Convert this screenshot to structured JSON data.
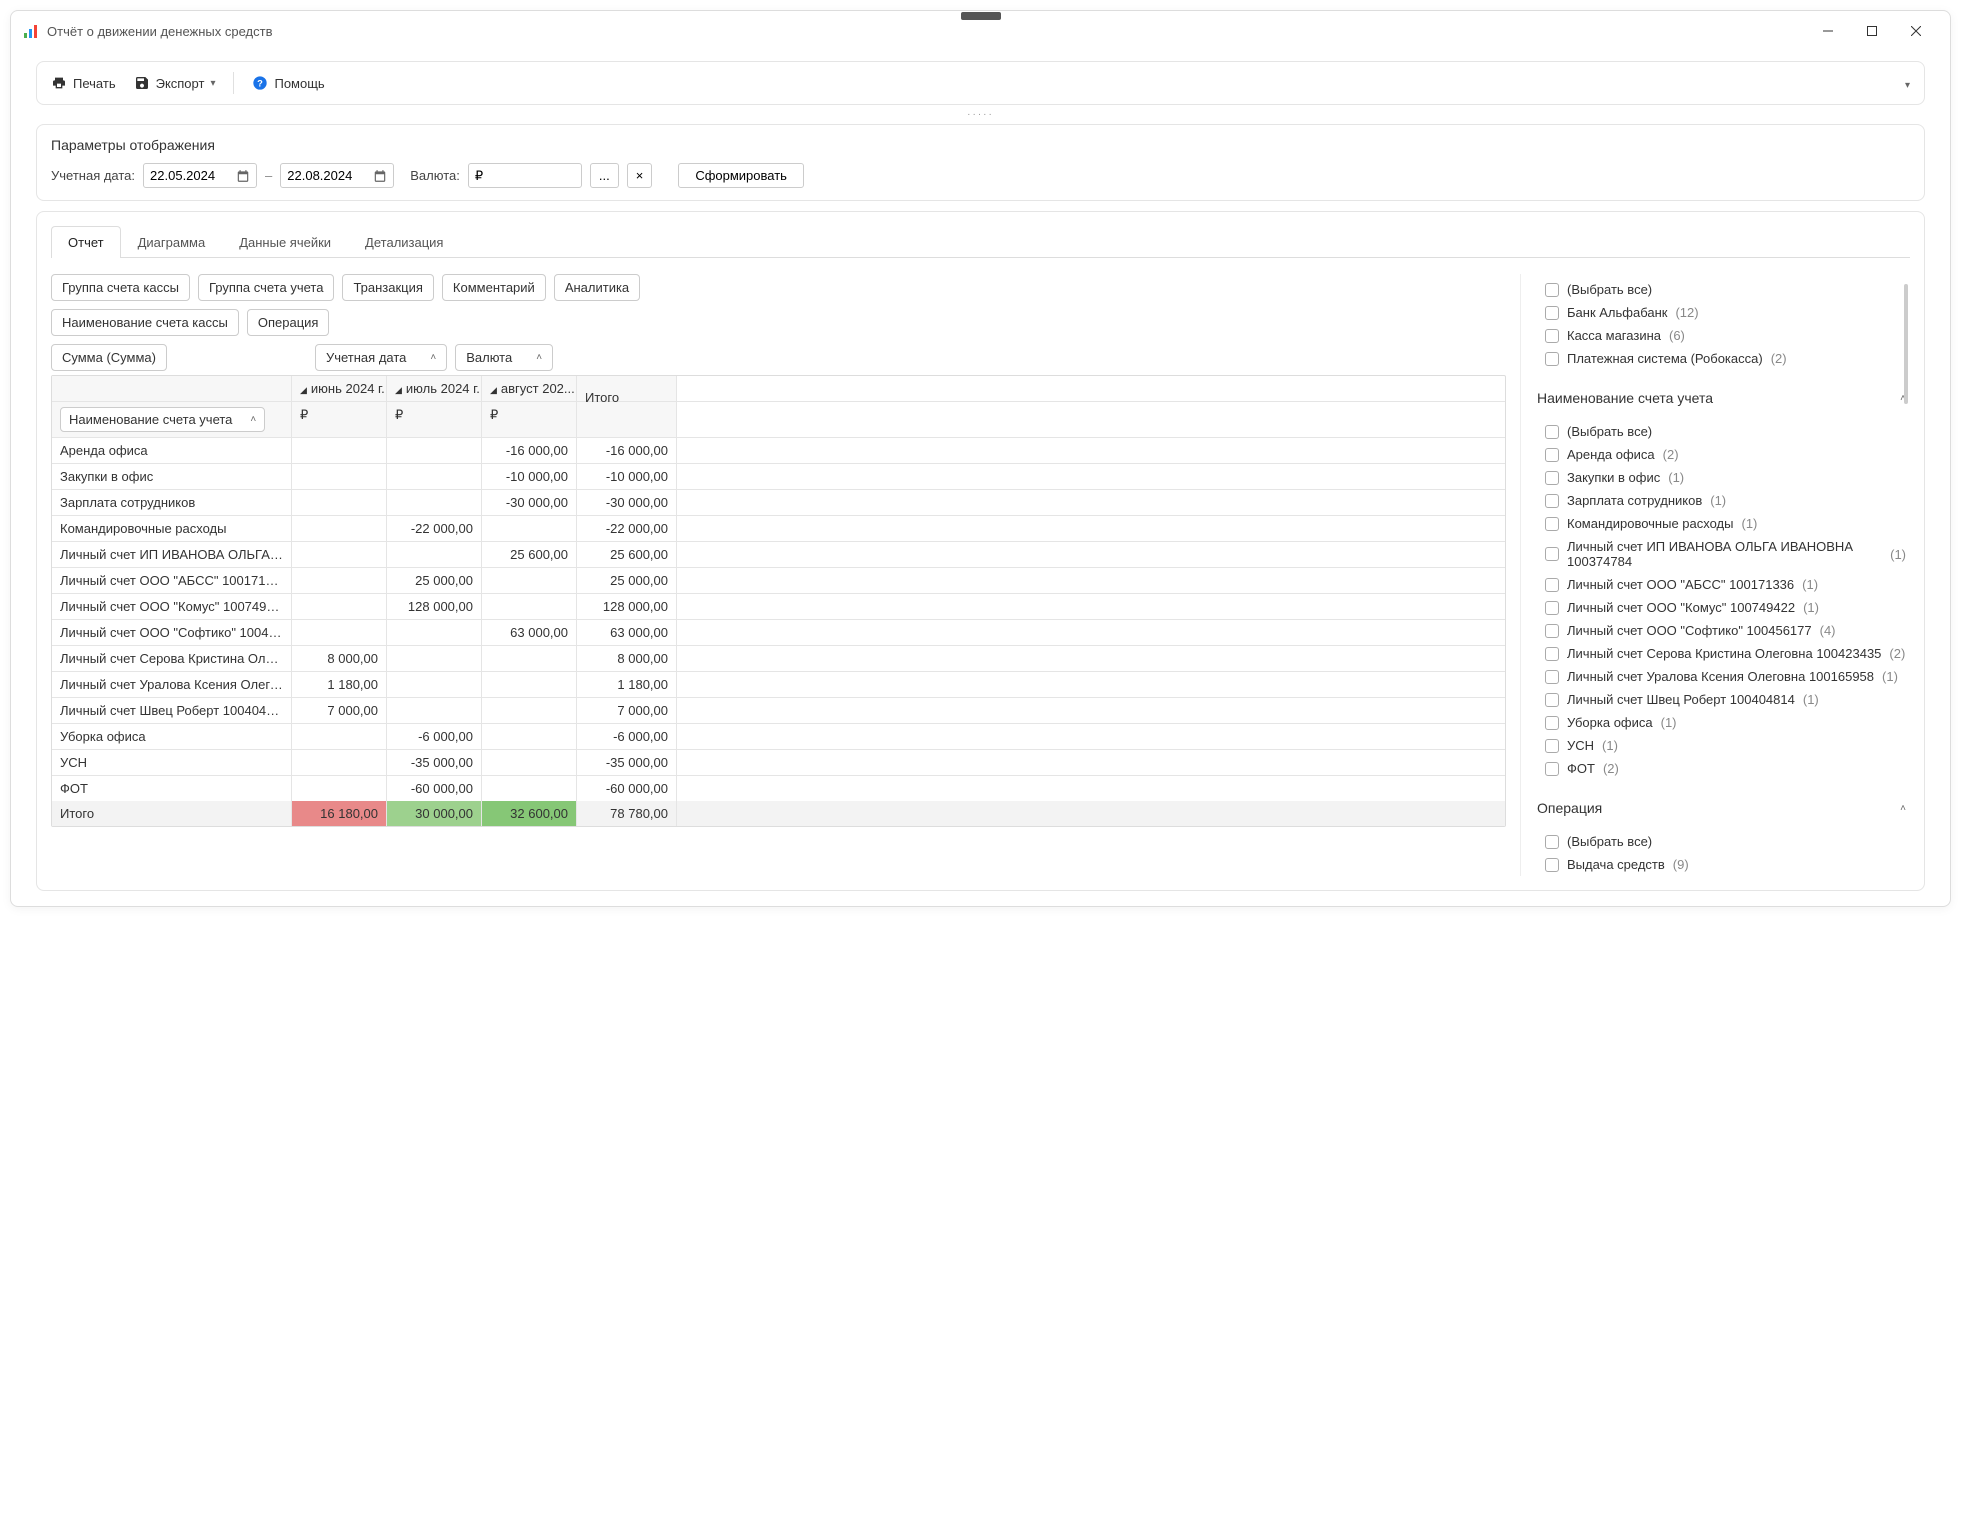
{
  "window": {
    "title": "Отчёт о движении денежных средств"
  },
  "toolbar": {
    "print": "Печать",
    "export": "Экспорт",
    "help": "Помощь"
  },
  "params": {
    "panel_title": "Параметры отображения",
    "date_label": "Учетная дата:",
    "date_from": "22.05.2024",
    "date_to": "22.08.2024",
    "currency_label": "Валюта:",
    "currency_value": "₽",
    "more_btn": "...",
    "clear_btn": "×",
    "generate_btn": "Сформировать"
  },
  "tabs": {
    "report": "Отчет",
    "diagram": "Диаграмма",
    "cell_data": "Данные ячейки",
    "detail": "Детализация"
  },
  "chips": {
    "group_kassa": "Группа счета кассы",
    "group_uchet": "Группа счета учета",
    "transaction": "Транзакция",
    "comment": "Комментарий",
    "analytics": "Аналитика",
    "name_kassa": "Наименование счета кассы",
    "operation": "Операция",
    "sum": "Сумма (Сумма)",
    "date_col": "Учетная дата",
    "currency_col": "Валюта",
    "row_field": "Наименование счета учета",
    "total_label": "Итого"
  },
  "months": {
    "jun": "июнь 2024 г.",
    "jul": "июль 2024 г.",
    "aug": "август 202...",
    "currency": "₽"
  },
  "rows": [
    {
      "name": "Аренда офиса",
      "jun": "",
      "jul": "",
      "aug": "-16 000,00",
      "total": "-16 000,00"
    },
    {
      "name": "Закупки в офис",
      "jun": "",
      "jul": "",
      "aug": "-10 000,00",
      "total": "-10 000,00"
    },
    {
      "name": "Зарплата сотрудников",
      "jun": "",
      "jul": "",
      "aug": "-30 000,00",
      "total": "-30 000,00"
    },
    {
      "name": "Командировочные расходы",
      "jun": "",
      "jul": "-22 000,00",
      "aug": "",
      "total": "-22 000,00"
    },
    {
      "name": "Личный счет ИП ИВАНОВА ОЛЬГА ИВАН...",
      "jun": "",
      "jul": "",
      "aug": "25 600,00",
      "total": "25 600,00"
    },
    {
      "name": "Личный счет ООО \"АБСС\" 100171336",
      "jun": "",
      "jul": "25 000,00",
      "aug": "",
      "total": "25 000,00"
    },
    {
      "name": "Личный счет ООО \"Комус\" 100749422",
      "jun": "",
      "jul": "128 000,00",
      "aug": "",
      "total": "128 000,00"
    },
    {
      "name": "Личный счет ООО \"Софтико\" 100456177",
      "jun": "",
      "jul": "",
      "aug": "63 000,00",
      "total": "63 000,00"
    },
    {
      "name": "Личный счет Серова Кристина Олеговна...",
      "jun": "8 000,00",
      "jul": "",
      "aug": "",
      "total": "8 000,00"
    },
    {
      "name": "Личный счет Уралова Ксения Олеговна 1...",
      "jun": "1 180,00",
      "jul": "",
      "aug": "",
      "total": "1 180,00"
    },
    {
      "name": "Личный счет Швец Роберт 100404814",
      "jun": "7 000,00",
      "jul": "",
      "aug": "",
      "total": "7 000,00"
    },
    {
      "name": "Уборка офиса",
      "jun": "",
      "jul": "-6 000,00",
      "aug": "",
      "total": "-6 000,00"
    },
    {
      "name": "УСН",
      "jun": "",
      "jul": "-35 000,00",
      "aug": "",
      "total": "-35 000,00"
    },
    {
      "name": "ФОТ",
      "jun": "",
      "jul": "-60 000,00",
      "aug": "",
      "total": "-60 000,00"
    }
  ],
  "totals": {
    "label": "Итого",
    "jun": "16 180,00",
    "jul": "30 000,00",
    "aug": "32 600,00",
    "total": "78 780,00"
  },
  "filters": {
    "kassa_naming": {
      "items": [
        {
          "label": "(Выбрать все)",
          "count": ""
        },
        {
          "label": "Банк Альфабанк",
          "count": "(12)"
        },
        {
          "label": "Касса магазина",
          "count": "(6)"
        },
        {
          "label": "Платежная система (Робокасса)",
          "count": "(2)"
        }
      ]
    },
    "uchet_naming": {
      "title": "Наименование счета учета",
      "items": [
        {
          "label": "(Выбрать все)",
          "count": ""
        },
        {
          "label": "Аренда офиса",
          "count": "(2)"
        },
        {
          "label": "Закупки в офис",
          "count": "(1)"
        },
        {
          "label": "Зарплата сотрудников",
          "count": "(1)"
        },
        {
          "label": "Командировочные расходы",
          "count": "(1)"
        },
        {
          "label": "Личный счет ИП ИВАНОВА ОЛЬГА ИВАНОВНА 100374784",
          "count": "(1)"
        },
        {
          "label": "Личный счет ООО \"АБСС\" 100171336",
          "count": "(1)"
        },
        {
          "label": "Личный счет ООО \"Комус\" 100749422",
          "count": "(1)"
        },
        {
          "label": "Личный счет ООО \"Софтико\" 100456177",
          "count": "(4)"
        },
        {
          "label": "Личный счет Серова Кристина Олеговна 100423435",
          "count": "(2)"
        },
        {
          "label": "Личный счет Уралова Ксения Олеговна 100165958",
          "count": "(1)"
        },
        {
          "label": "Личный счет Швец Роберт 100404814",
          "count": "(1)"
        },
        {
          "label": "Уборка офиса",
          "count": "(1)"
        },
        {
          "label": "УСН",
          "count": "(1)"
        },
        {
          "label": "ФОТ",
          "count": "(2)"
        }
      ]
    },
    "operation": {
      "title": "Операция",
      "items": [
        {
          "label": "(Выбрать все)",
          "count": ""
        },
        {
          "label": "Выдача средств",
          "count": "(9)"
        }
      ]
    }
  }
}
